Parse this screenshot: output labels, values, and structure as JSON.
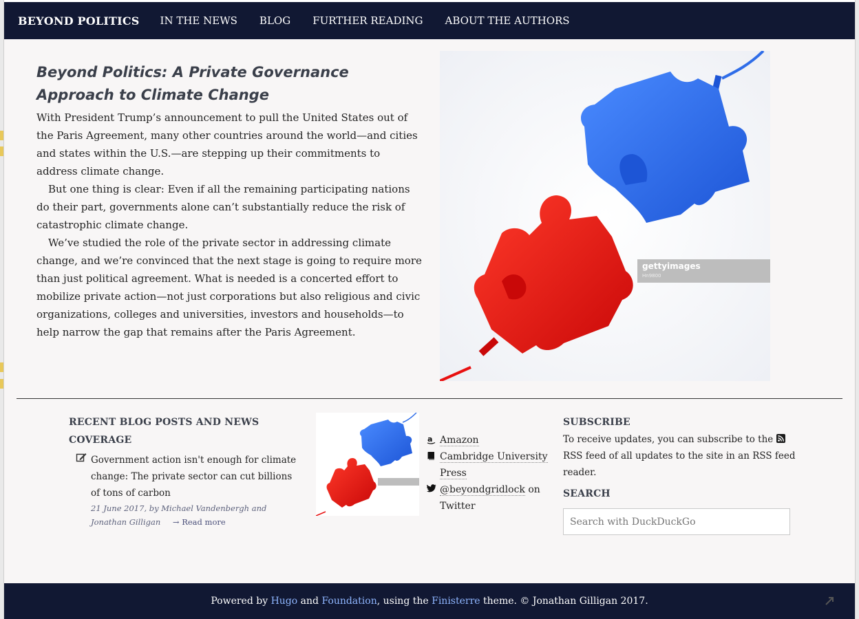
{
  "brand": "BEYOND POLITICS",
  "nav": {
    "items": [
      "IN THE NEWS",
      "BLOG",
      "FURTHER READING",
      "ABOUT THE AUTHORS"
    ]
  },
  "hero": {
    "title": "Beyond Politics: A Private Governance Approach to Climate Change",
    "paragraphs": [
      "With President Trump’s announcement to pull the United States out of the Paris Agreement, many other countries around the world—and cities and states within the U.S.—are stepping up their commitments to address climate change.",
      "But one thing is clear: Even if all the remaining participating nations do their part, governments alone can’t substantially reduce the risk of catastrophic climate change.",
      "We’ve studied the role of the private sector in addressing climate change, and we’re convinced that the next stage is going to require more than just political agreement. What is needed is a concerted effort to mobilize private action—not just corporations but also religious and civic organizations, colleges and universities, investors and households—to help narrow the gap that remains after the Paris Agreement."
    ],
    "image_watermark": "gettyimages",
    "image_watermark_sub": "Hn9800"
  },
  "recent": {
    "title": "RECENT BLOG POSTS AND NEWS COVERAGE",
    "post_title": "Government action isn't enough for climate change: The private sector can cut billions of tons of carbon",
    "post_meta": "21 June 2017, by Michael Vandenbergh and Jonathan Gilligan",
    "read_more": "→ Read more"
  },
  "links": {
    "amazon": "Amazon",
    "cambridge": "Cambridge University Press",
    "twitter_handle": "@beyondgridlock",
    "twitter_on": " on",
    "twitter_site": "Twitter"
  },
  "subscribe": {
    "title": "SUBSCRIBE",
    "text_before": "To receive updates, you can subscribe to the ",
    "text_after": " RSS feed of all updates to the site in an RSS feed reader.",
    "search_title": "SEARCH",
    "search_placeholder": "Search with DuckDuckGo"
  },
  "footer": {
    "powered": "Powered by ",
    "hugo": "Hugo",
    "and": " and ",
    "foundation": "Foundation",
    "using": ", using the ",
    "theme": "Finisterre",
    "rest": " theme. © Jonathan Gilligan 2017."
  },
  "colors": {
    "navbar": "#111833",
    "page_bg": "#f8f6f6",
    "link": "#8fb6ff",
    "puzzle_blue": "#2f6de8",
    "puzzle_red": "#e81010"
  }
}
